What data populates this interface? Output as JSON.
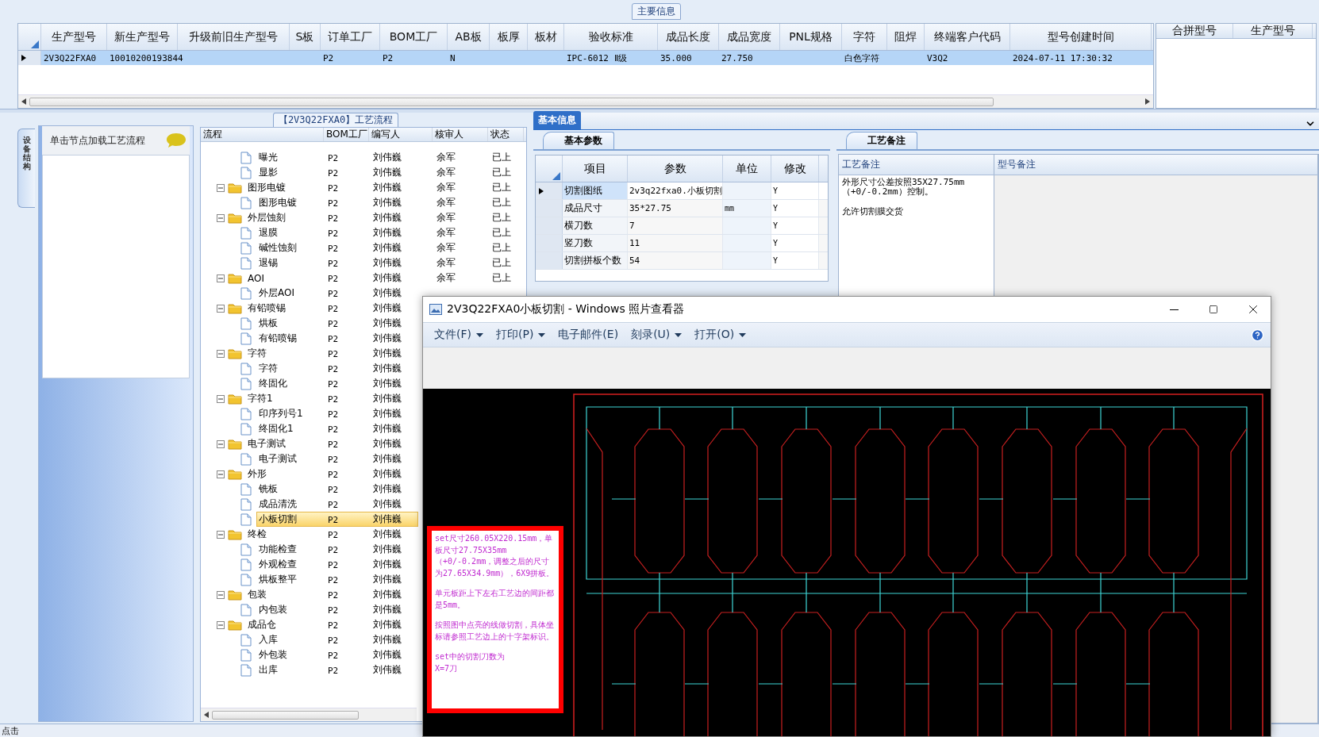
{
  "main_info": {
    "caption": "主要信息",
    "columns": [
      "生产型号",
      "新生产型号",
      "升级前旧生产型号",
      "S板",
      "订单工厂",
      "BOM工厂",
      "AB板",
      "板厚",
      "板材",
      "验收标准",
      "成品长度",
      "成品宽度",
      "PNL规格",
      "字符",
      "阻焊",
      "终端客户代码",
      "型号创建时间"
    ],
    "rows": [
      {
        "selected": true,
        "cells": [
          "2V3Q22FXA0",
          "10010200193844",
          null,
          null,
          "P2",
          "P2",
          "N",
          null,
          null,
          "IPC-6012 Ⅱ级",
          "35.000",
          "27.750",
          null,
          "白色字符",
          null,
          "V3Q2",
          "2024-07-11 17:30:32"
        ]
      }
    ],
    "merge_columns": [
      "合拼型号",
      "生产型号"
    ]
  },
  "process_panel": {
    "side_tab": "设备结构",
    "hint": "单击节点加载工艺流程",
    "title": "【2V3Q22FXA0】工艺流程",
    "columns": [
      "流程",
      "BOM工厂",
      "编写人",
      "核审人",
      "状态"
    ],
    "rows": [
      {
        "kind": "file",
        "label": "曝光",
        "bom": "P2",
        "author": "刘伟巍",
        "reviewer": "余军",
        "status": "已上",
        "selected": false
      },
      {
        "kind": "file",
        "label": "显影",
        "bom": "P2",
        "author": "刘伟巍",
        "reviewer": "余军",
        "status": "已上",
        "selected": false
      },
      {
        "kind": "folder",
        "label": "图形电镀",
        "expanded": true,
        "bom": "P2",
        "author": "刘伟巍",
        "reviewer": "余军",
        "status": "已上",
        "selected": false,
        "children": [
          {
            "kind": "file",
            "label": "图形电镀",
            "bom": "P2",
            "author": "刘伟巍",
            "reviewer": "余军",
            "status": "已上",
            "selected": false
          }
        ]
      },
      {
        "kind": "folder",
        "label": "外层蚀刻",
        "expanded": true,
        "bom": "P2",
        "author": "刘伟巍",
        "reviewer": "余军",
        "status": "已上",
        "selected": false,
        "children": [
          {
            "kind": "file",
            "label": "退膜",
            "bom": "P2",
            "author": "刘伟巍",
            "reviewer": "余军",
            "status": "已上",
            "selected": false
          },
          {
            "kind": "file",
            "label": "碱性蚀刻",
            "bom": "P2",
            "author": "刘伟巍",
            "reviewer": "余军",
            "status": "已上",
            "selected": false
          },
          {
            "kind": "file",
            "label": "退锡",
            "bom": "P2",
            "author": "刘伟巍",
            "reviewer": "余军",
            "status": "已上",
            "selected": false
          }
        ]
      },
      {
        "kind": "folder",
        "label": "AOI",
        "expanded": true,
        "bom": "P2",
        "author": "刘伟巍",
        "reviewer": "余军",
        "status": "已上",
        "selected": false,
        "children": [
          {
            "kind": "file",
            "label": "外层AOI",
            "bom": "P2",
            "author": "刘伟巍",
            "selected": false
          }
        ]
      },
      {
        "kind": "folder",
        "label": "有铅喷锡",
        "expanded": true,
        "bom": "P2",
        "author": "刘伟巍",
        "selected": false,
        "children": [
          {
            "kind": "file",
            "label": "烘板",
            "bom": "P2",
            "author": "刘伟巍",
            "selected": false
          },
          {
            "kind": "file",
            "label": "有铅喷锡",
            "bom": "P2",
            "author": "刘伟巍",
            "selected": false
          }
        ]
      },
      {
        "kind": "folder",
        "label": "字符",
        "expanded": true,
        "bom": "P2",
        "author": "刘伟巍",
        "selected": false,
        "children": [
          {
            "kind": "file",
            "label": "字符",
            "bom": "P2",
            "author": "刘伟巍",
            "selected": false
          },
          {
            "kind": "file",
            "label": "终固化",
            "bom": "P2",
            "author": "刘伟巍",
            "selected": false
          }
        ]
      },
      {
        "kind": "folder",
        "label": "字符1",
        "expanded": true,
        "bom": "P2",
        "author": "刘伟巍",
        "selected": false,
        "children": [
          {
            "kind": "file",
            "label": "印序列号1",
            "bom": "P2",
            "author": "刘伟巍",
            "selected": false
          },
          {
            "kind": "file",
            "label": "终固化1",
            "bom": "P2",
            "author": "刘伟巍",
            "selected": false
          }
        ]
      },
      {
        "kind": "folder",
        "label": "电子测试",
        "expanded": true,
        "bom": "P2",
        "author": "刘伟巍",
        "selected": false,
        "children": [
          {
            "kind": "file",
            "label": "电子测试",
            "bom": "P2",
            "author": "刘伟巍",
            "selected": false
          }
        ]
      },
      {
        "kind": "folder",
        "label": "外形",
        "expanded": true,
        "bom": "P2",
        "author": "刘伟巍",
        "selected": false,
        "children": [
          {
            "kind": "file",
            "label": "铣板",
            "bom": "P2",
            "author": "刘伟巍",
            "selected": false
          },
          {
            "kind": "file",
            "label": "成品清洗",
            "bom": "P2",
            "author": "刘伟巍",
            "selected": false
          },
          {
            "kind": "file",
            "label": "小板切割",
            "bom": "P2",
            "author": "刘伟巍",
            "selected": true
          }
        ]
      },
      {
        "kind": "folder",
        "label": "终检",
        "expanded": true,
        "bom": "P2",
        "author": "刘伟巍",
        "selected": false,
        "children": [
          {
            "kind": "file",
            "label": "功能检查",
            "bom": "P2",
            "author": "刘伟巍",
            "selected": false
          },
          {
            "kind": "file",
            "label": "外观检查",
            "bom": "P2",
            "author": "刘伟巍",
            "selected": false
          },
          {
            "kind": "file",
            "label": "烘板整平",
            "bom": "P2",
            "author": "刘伟巍",
            "selected": false
          }
        ]
      },
      {
        "kind": "folder",
        "label": "包装",
        "expanded": true,
        "bom": "P2",
        "author": "刘伟巍",
        "selected": false,
        "children": [
          {
            "kind": "file",
            "label": "内包装",
            "bom": "P2",
            "author": "刘伟巍",
            "selected": false
          }
        ]
      },
      {
        "kind": "folder",
        "label": "成品仓",
        "expanded": true,
        "bom": "P2",
        "author": "刘伟巍",
        "selected": false,
        "children": [
          {
            "kind": "file",
            "label": "入库",
            "bom": "P2",
            "author": "刘伟巍",
            "selected": false
          },
          {
            "kind": "file",
            "label": "外包装",
            "bom": "P2",
            "author": "刘伟巍",
            "selected": false
          },
          {
            "kind": "file",
            "label": "出库",
            "bom": "P2",
            "author": "刘伟巍",
            "selected": false
          }
        ]
      }
    ]
  },
  "basic_info": {
    "tab": "基本信息",
    "params": {
      "tab": "基本参数",
      "columns": [
        "项目",
        "参数",
        "单位",
        "修改"
      ],
      "rows": [
        {
          "selected": true,
          "item": "切割图纸",
          "value": "2v3q22fxa0.小板切割",
          "unit": null,
          "modify": "Y"
        },
        {
          "selected": false,
          "item": "成品尺寸",
          "value": "35*27.75",
          "unit": "mm",
          "modify": "Y"
        },
        {
          "selected": false,
          "item": "横刀数",
          "value": "7",
          "unit": null,
          "modify": "Y"
        },
        {
          "selected": false,
          "item": "竖刀数",
          "value": "11",
          "unit": null,
          "modify": "Y"
        },
        {
          "selected": false,
          "item": "切割拼板个数",
          "value": "54",
          "unit": null,
          "modify": "Y"
        }
      ]
    },
    "remarks": {
      "tab": "工艺备注",
      "columns": [
        "工艺备注",
        "型号备注"
      ],
      "process_note": [
        "外形尺寸公差按照35X27.75mm\n（+0/-0.2mm）控制。",
        "允许切割膜交货"
      ]
    }
  },
  "photo_viewer": {
    "title": "2V3Q22FXA0小板切割 - Windows 照片查看器",
    "menu": [
      {
        "label": "文件(F)",
        "dropdown": true
      },
      {
        "label": "打印(P)",
        "dropdown": true
      },
      {
        "label": "电子邮件(E)",
        "dropdown": false
      },
      {
        "label": "刻录(U)",
        "dropdown": true
      },
      {
        "label": "打开(O)",
        "dropdown": true
      }
    ],
    "note": [
      "set尺寸260.05X220.15mm，单板尺寸27.75X35mm\n（+0/-0.2mm，调整之后的尺寸为27.65X34.9mm），6X9拼板。",
      "单元板距上下左右工艺边的间距都是5mm。",
      "按照图中点亮的线做切割，具体坐标请参照工艺边上的十字架标识。",
      "set中的切割刀数为\nX=7刀"
    ]
  },
  "status_bar": {
    "text": "点击"
  }
}
